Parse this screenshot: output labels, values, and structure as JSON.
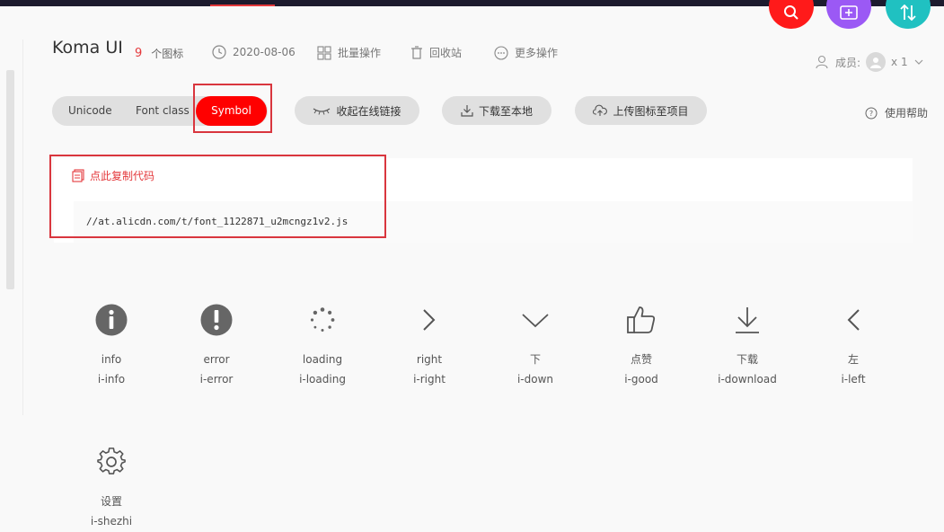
{
  "project": {
    "title": "Koma UI",
    "icon_count": "9",
    "icon_count_label": "个图标",
    "date": "2020-08-06",
    "batch_label": "批量操作",
    "trash_label": "回收站",
    "more_label": "更多操作"
  },
  "members": {
    "label": "成员:",
    "count": "x 1"
  },
  "tabs": [
    {
      "label": "Unicode"
    },
    {
      "label": "Font class"
    },
    {
      "label": "Symbol"
    }
  ],
  "actions": {
    "collapse_link": "收起在线链接",
    "download_local": "下载至本地",
    "upload_to_project": "上传图标至项目",
    "help": "使用帮助"
  },
  "code": {
    "copy_label": "点此复制代码",
    "url": "//at.alicdn.com/t/font_1122871_u2mcngz1v2.js"
  },
  "icons": [
    {
      "name": "info",
      "class": "i-info",
      "icon": "info-circle-icon"
    },
    {
      "name": "error",
      "class": "i-error",
      "icon": "exclamation-circle-icon"
    },
    {
      "name": "loading",
      "class": "i-loading",
      "icon": "loading-spinner-icon"
    },
    {
      "name": "right",
      "class": "i-right",
      "icon": "chevron-right-icon"
    },
    {
      "name": "下",
      "class": "i-down",
      "icon": "chevron-down-icon"
    },
    {
      "name": "点赞",
      "class": "i-good",
      "icon": "thumbs-up-icon"
    },
    {
      "name": "下载",
      "class": "i-download",
      "icon": "download-icon"
    },
    {
      "name": "左",
      "class": "i-left",
      "icon": "chevron-left-icon"
    },
    {
      "name": "设置",
      "class": "i-shezhi",
      "icon": "gear-icon"
    }
  ],
  "colors": {
    "accent": "#ff0000",
    "highlight_box": "#d9363e",
    "fab_search": "#ff1a1a",
    "fab_add": "#9b59f5",
    "fab_sort": "#20c1c1"
  }
}
